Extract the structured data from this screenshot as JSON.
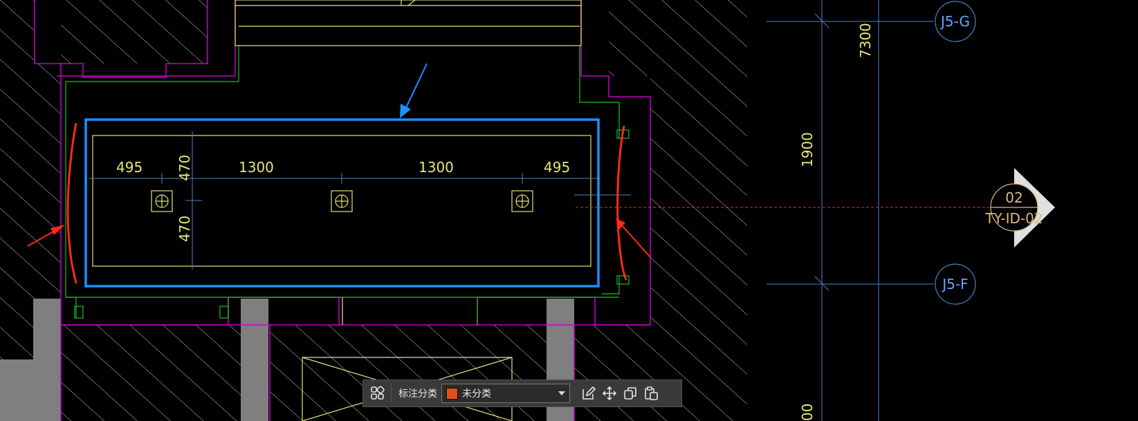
{
  "drawing": {
    "dimensions": {
      "top_row": [
        "495",
        "1300",
        "1300",
        "495"
      ],
      "vertical_left": [
        "470",
        "470"
      ],
      "grid_right": [
        "7300",
        "1900",
        "00"
      ]
    },
    "grid_bubbles": {
      "upper": "J5-G",
      "lower": "J5-F"
    },
    "section_marker": {
      "number": "02",
      "sheet": "TY-ID-02"
    }
  },
  "colors": {
    "background": "#000000",
    "wall_outline": "#c800c8",
    "hatch": "#c8c8c8",
    "yellow_line": "#e5e57a",
    "green_line": "#18c818",
    "dim_line": "#4c83c8",
    "blue_selection": "#1e90ff",
    "red_markup": "#ff2a1a",
    "gray_column": "#7f7f7f",
    "section_fill": "#e0e0e0",
    "dim_text": "#e8e87a",
    "grid_text": "#6aa4ff",
    "marker_text": "#e0b882",
    "swatch": "#e0501a"
  },
  "toolbar": {
    "category_label": "标注分类",
    "category_value": "未分类",
    "icons": {
      "layout": "grid-icon",
      "edit": "edit-icon",
      "move": "move-icon",
      "copy": "copy-icon",
      "paste": "paste-icon"
    }
  }
}
